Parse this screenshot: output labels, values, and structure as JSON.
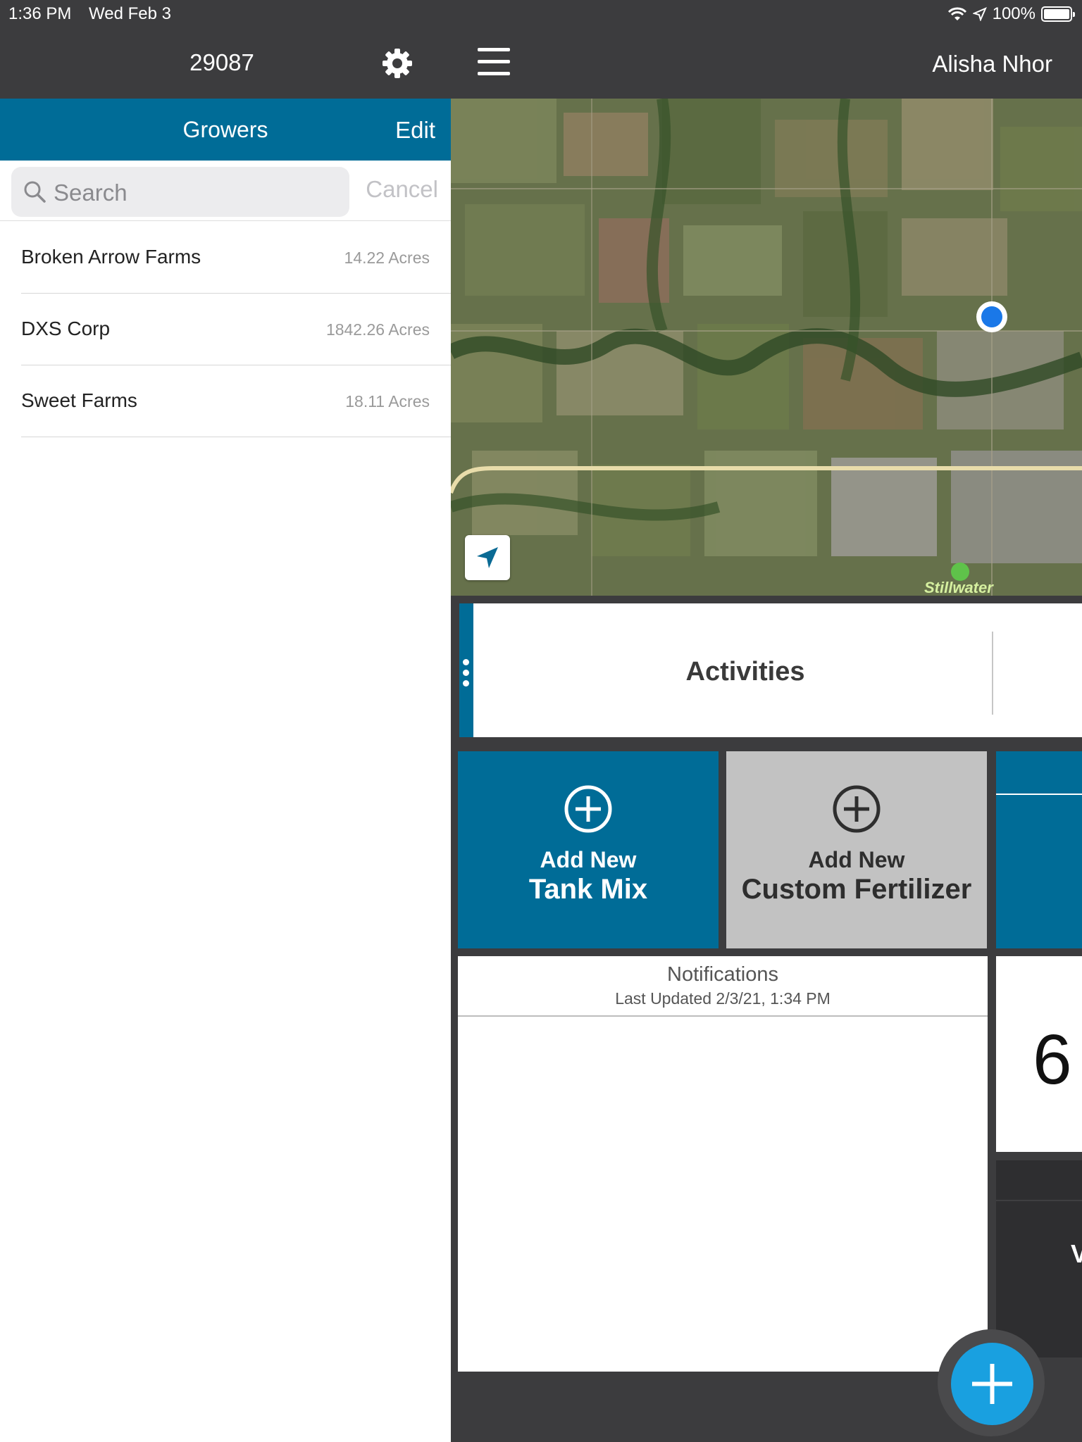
{
  "status_bar": {
    "time": "1:36 PM",
    "date": "Wed Feb 3",
    "battery": "100%"
  },
  "left_header": {
    "title": "29087"
  },
  "growers": {
    "title": "Growers",
    "edit_label": "Edit",
    "search_placeholder": "Search",
    "cancel_label": "Cancel",
    "items": [
      {
        "name": "Broken Arrow Farms",
        "acres": "14.22 Acres"
      },
      {
        "name": "DXS Corp",
        "acres": "1842.26 Acres"
      },
      {
        "name": "Sweet Farms",
        "acres": "18.11 Acres"
      }
    ]
  },
  "right_header": {
    "user_name": "Alisha Nhor"
  },
  "map": {
    "place_label": "Stillwater"
  },
  "activities": {
    "label": "Activities"
  },
  "tiles": {
    "tank_mix": {
      "line1": "Add New",
      "line2": "Tank Mix"
    },
    "custom_fertilizer": {
      "line1": "Add New",
      "line2": "Custom Fertilizer"
    }
  },
  "notifications": {
    "title": "Notifications",
    "last_updated": "Last Updated 2/3/21, 1:34 PM"
  },
  "edge_cards": {
    "big_number_partial": "6",
    "letter_partial": "V"
  },
  "colors": {
    "brand_blue": "#006c97",
    "fab_blue": "#19a0e0",
    "header_dark": "#3c3c3e",
    "tile_gray": "#c2c2c2"
  }
}
